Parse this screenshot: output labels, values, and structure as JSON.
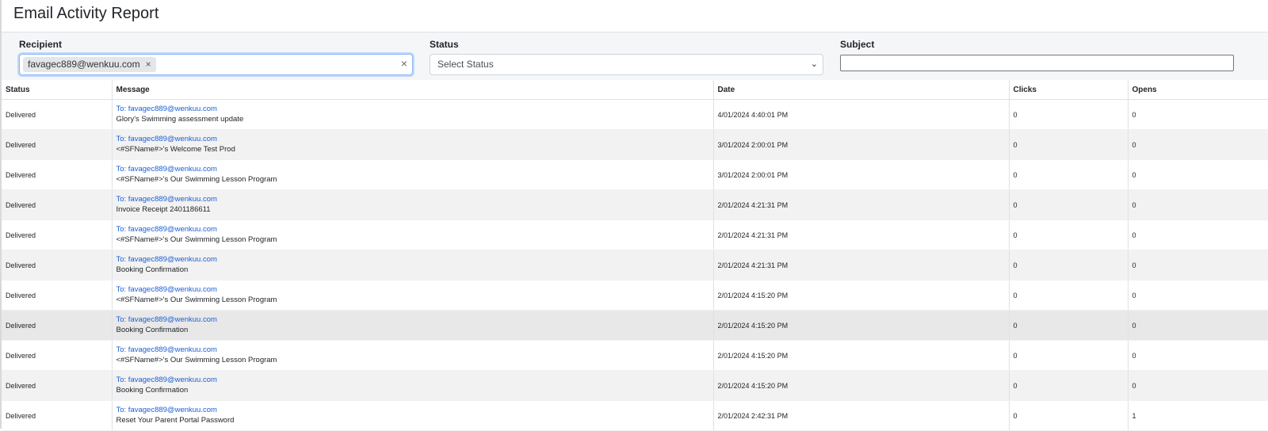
{
  "page": {
    "title": "Email Activity Report"
  },
  "filters": {
    "recipient_label": "Recipient",
    "recipient_chip": "favagec889@wenkuu.com",
    "chip_remove": "×",
    "clear_all": "×",
    "status_label": "Status",
    "status_placeholder": "Select Status",
    "subject_label": "Subject",
    "subject_value": ""
  },
  "table": {
    "headers": {
      "status": "Status",
      "message": "Message",
      "date": "Date",
      "clicks": "Clicks",
      "opens": "Opens"
    },
    "rows": [
      {
        "status": "Delivered",
        "to": "To: favagec889@wenkuu.com",
        "message": "Glory's Swimming assessment update",
        "date": "4/01/2024 4:40:01 PM",
        "clicks": "0",
        "opens": "0"
      },
      {
        "status": "Delivered",
        "to": "To: favagec889@wenkuu.com",
        "message": "<#SFName#>'s Welcome Test Prod",
        "date": "3/01/2024 2:00:01 PM",
        "clicks": "0",
        "opens": "0"
      },
      {
        "status": "Delivered",
        "to": "To: favagec889@wenkuu.com",
        "message": "<#SFName#>'s Our Swimming Lesson Program",
        "date": "3/01/2024 2:00:01 PM",
        "clicks": "0",
        "opens": "0"
      },
      {
        "status": "Delivered",
        "to": "To: favagec889@wenkuu.com",
        "message": "Invoice Receipt 2401186611",
        "date": "2/01/2024 4:21:31 PM",
        "clicks": "0",
        "opens": "0"
      },
      {
        "status": "Delivered",
        "to": "To: favagec889@wenkuu.com",
        "message": "<#SFName#>'s Our Swimming Lesson Program",
        "date": "2/01/2024 4:21:31 PM",
        "clicks": "0",
        "opens": "0"
      },
      {
        "status": "Delivered",
        "to": "To: favagec889@wenkuu.com",
        "message": "Booking Confirmation",
        "date": "2/01/2024 4:21:31 PM",
        "clicks": "0",
        "opens": "0"
      },
      {
        "status": "Delivered",
        "to": "To: favagec889@wenkuu.com",
        "message": "<#SFName#>'s Our Swimming Lesson Program",
        "date": "2/01/2024 4:15:20 PM",
        "clicks": "0",
        "opens": "0"
      },
      {
        "status": "Delivered",
        "to": "To: favagec889@wenkuu.com",
        "message": "Booking Confirmation",
        "date": "2/01/2024 4:15:20 PM",
        "clicks": "0",
        "opens": "0"
      },
      {
        "status": "Delivered",
        "to": "To: favagec889@wenkuu.com",
        "message": "<#SFName#>'s Our Swimming Lesson Program",
        "date": "2/01/2024 4:15:20 PM",
        "clicks": "0",
        "opens": "0"
      },
      {
        "status": "Delivered",
        "to": "To: favagec889@wenkuu.com",
        "message": "Booking Confirmation",
        "date": "2/01/2024 4:15:20 PM",
        "clicks": "0",
        "opens": "0"
      },
      {
        "status": "Delivered",
        "to": "To: favagec889@wenkuu.com",
        "message": "Reset Your Parent Portal Password",
        "date": "2/01/2024 2:42:31 PM",
        "clicks": "0",
        "opens": "1"
      }
    ]
  },
  "colors": {
    "link": "#1a5fd6",
    "focus_border": "#86b7fe",
    "stripe": "#f2f2f2"
  }
}
